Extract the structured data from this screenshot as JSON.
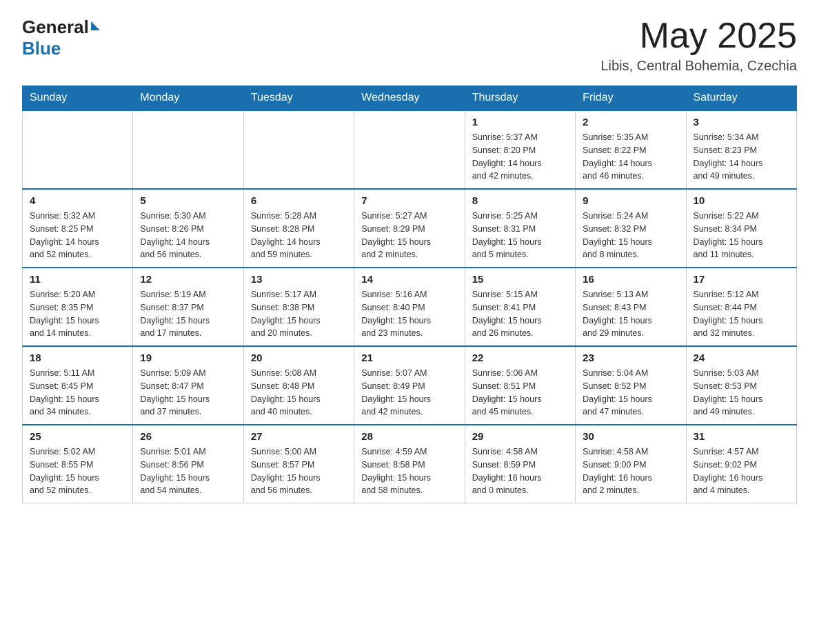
{
  "header": {
    "logo_general": "General",
    "logo_blue": "Blue",
    "month_title": "May 2025",
    "location": "Libis, Central Bohemia, Czechia"
  },
  "days_of_week": [
    "Sunday",
    "Monday",
    "Tuesday",
    "Wednesday",
    "Thursday",
    "Friday",
    "Saturday"
  ],
  "weeks": [
    [
      {
        "day": "",
        "info": ""
      },
      {
        "day": "",
        "info": ""
      },
      {
        "day": "",
        "info": ""
      },
      {
        "day": "",
        "info": ""
      },
      {
        "day": "1",
        "info": "Sunrise: 5:37 AM\nSunset: 8:20 PM\nDaylight: 14 hours\nand 42 minutes."
      },
      {
        "day": "2",
        "info": "Sunrise: 5:35 AM\nSunset: 8:22 PM\nDaylight: 14 hours\nand 46 minutes."
      },
      {
        "day": "3",
        "info": "Sunrise: 5:34 AM\nSunset: 8:23 PM\nDaylight: 14 hours\nand 49 minutes."
      }
    ],
    [
      {
        "day": "4",
        "info": "Sunrise: 5:32 AM\nSunset: 8:25 PM\nDaylight: 14 hours\nand 52 minutes."
      },
      {
        "day": "5",
        "info": "Sunrise: 5:30 AM\nSunset: 8:26 PM\nDaylight: 14 hours\nand 56 minutes."
      },
      {
        "day": "6",
        "info": "Sunrise: 5:28 AM\nSunset: 8:28 PM\nDaylight: 14 hours\nand 59 minutes."
      },
      {
        "day": "7",
        "info": "Sunrise: 5:27 AM\nSunset: 8:29 PM\nDaylight: 15 hours\nand 2 minutes."
      },
      {
        "day": "8",
        "info": "Sunrise: 5:25 AM\nSunset: 8:31 PM\nDaylight: 15 hours\nand 5 minutes."
      },
      {
        "day": "9",
        "info": "Sunrise: 5:24 AM\nSunset: 8:32 PM\nDaylight: 15 hours\nand 8 minutes."
      },
      {
        "day": "10",
        "info": "Sunrise: 5:22 AM\nSunset: 8:34 PM\nDaylight: 15 hours\nand 11 minutes."
      }
    ],
    [
      {
        "day": "11",
        "info": "Sunrise: 5:20 AM\nSunset: 8:35 PM\nDaylight: 15 hours\nand 14 minutes."
      },
      {
        "day": "12",
        "info": "Sunrise: 5:19 AM\nSunset: 8:37 PM\nDaylight: 15 hours\nand 17 minutes."
      },
      {
        "day": "13",
        "info": "Sunrise: 5:17 AM\nSunset: 8:38 PM\nDaylight: 15 hours\nand 20 minutes."
      },
      {
        "day": "14",
        "info": "Sunrise: 5:16 AM\nSunset: 8:40 PM\nDaylight: 15 hours\nand 23 minutes."
      },
      {
        "day": "15",
        "info": "Sunrise: 5:15 AM\nSunset: 8:41 PM\nDaylight: 15 hours\nand 26 minutes."
      },
      {
        "day": "16",
        "info": "Sunrise: 5:13 AM\nSunset: 8:43 PM\nDaylight: 15 hours\nand 29 minutes."
      },
      {
        "day": "17",
        "info": "Sunrise: 5:12 AM\nSunset: 8:44 PM\nDaylight: 15 hours\nand 32 minutes."
      }
    ],
    [
      {
        "day": "18",
        "info": "Sunrise: 5:11 AM\nSunset: 8:45 PM\nDaylight: 15 hours\nand 34 minutes."
      },
      {
        "day": "19",
        "info": "Sunrise: 5:09 AM\nSunset: 8:47 PM\nDaylight: 15 hours\nand 37 minutes."
      },
      {
        "day": "20",
        "info": "Sunrise: 5:08 AM\nSunset: 8:48 PM\nDaylight: 15 hours\nand 40 minutes."
      },
      {
        "day": "21",
        "info": "Sunrise: 5:07 AM\nSunset: 8:49 PM\nDaylight: 15 hours\nand 42 minutes."
      },
      {
        "day": "22",
        "info": "Sunrise: 5:06 AM\nSunset: 8:51 PM\nDaylight: 15 hours\nand 45 minutes."
      },
      {
        "day": "23",
        "info": "Sunrise: 5:04 AM\nSunset: 8:52 PM\nDaylight: 15 hours\nand 47 minutes."
      },
      {
        "day": "24",
        "info": "Sunrise: 5:03 AM\nSunset: 8:53 PM\nDaylight: 15 hours\nand 49 minutes."
      }
    ],
    [
      {
        "day": "25",
        "info": "Sunrise: 5:02 AM\nSunset: 8:55 PM\nDaylight: 15 hours\nand 52 minutes."
      },
      {
        "day": "26",
        "info": "Sunrise: 5:01 AM\nSunset: 8:56 PM\nDaylight: 15 hours\nand 54 minutes."
      },
      {
        "day": "27",
        "info": "Sunrise: 5:00 AM\nSunset: 8:57 PM\nDaylight: 15 hours\nand 56 minutes."
      },
      {
        "day": "28",
        "info": "Sunrise: 4:59 AM\nSunset: 8:58 PM\nDaylight: 15 hours\nand 58 minutes."
      },
      {
        "day": "29",
        "info": "Sunrise: 4:58 AM\nSunset: 8:59 PM\nDaylight: 16 hours\nand 0 minutes."
      },
      {
        "day": "30",
        "info": "Sunrise: 4:58 AM\nSunset: 9:00 PM\nDaylight: 16 hours\nand 2 minutes."
      },
      {
        "day": "31",
        "info": "Sunrise: 4:57 AM\nSunset: 9:02 PM\nDaylight: 16 hours\nand 4 minutes."
      }
    ]
  ]
}
